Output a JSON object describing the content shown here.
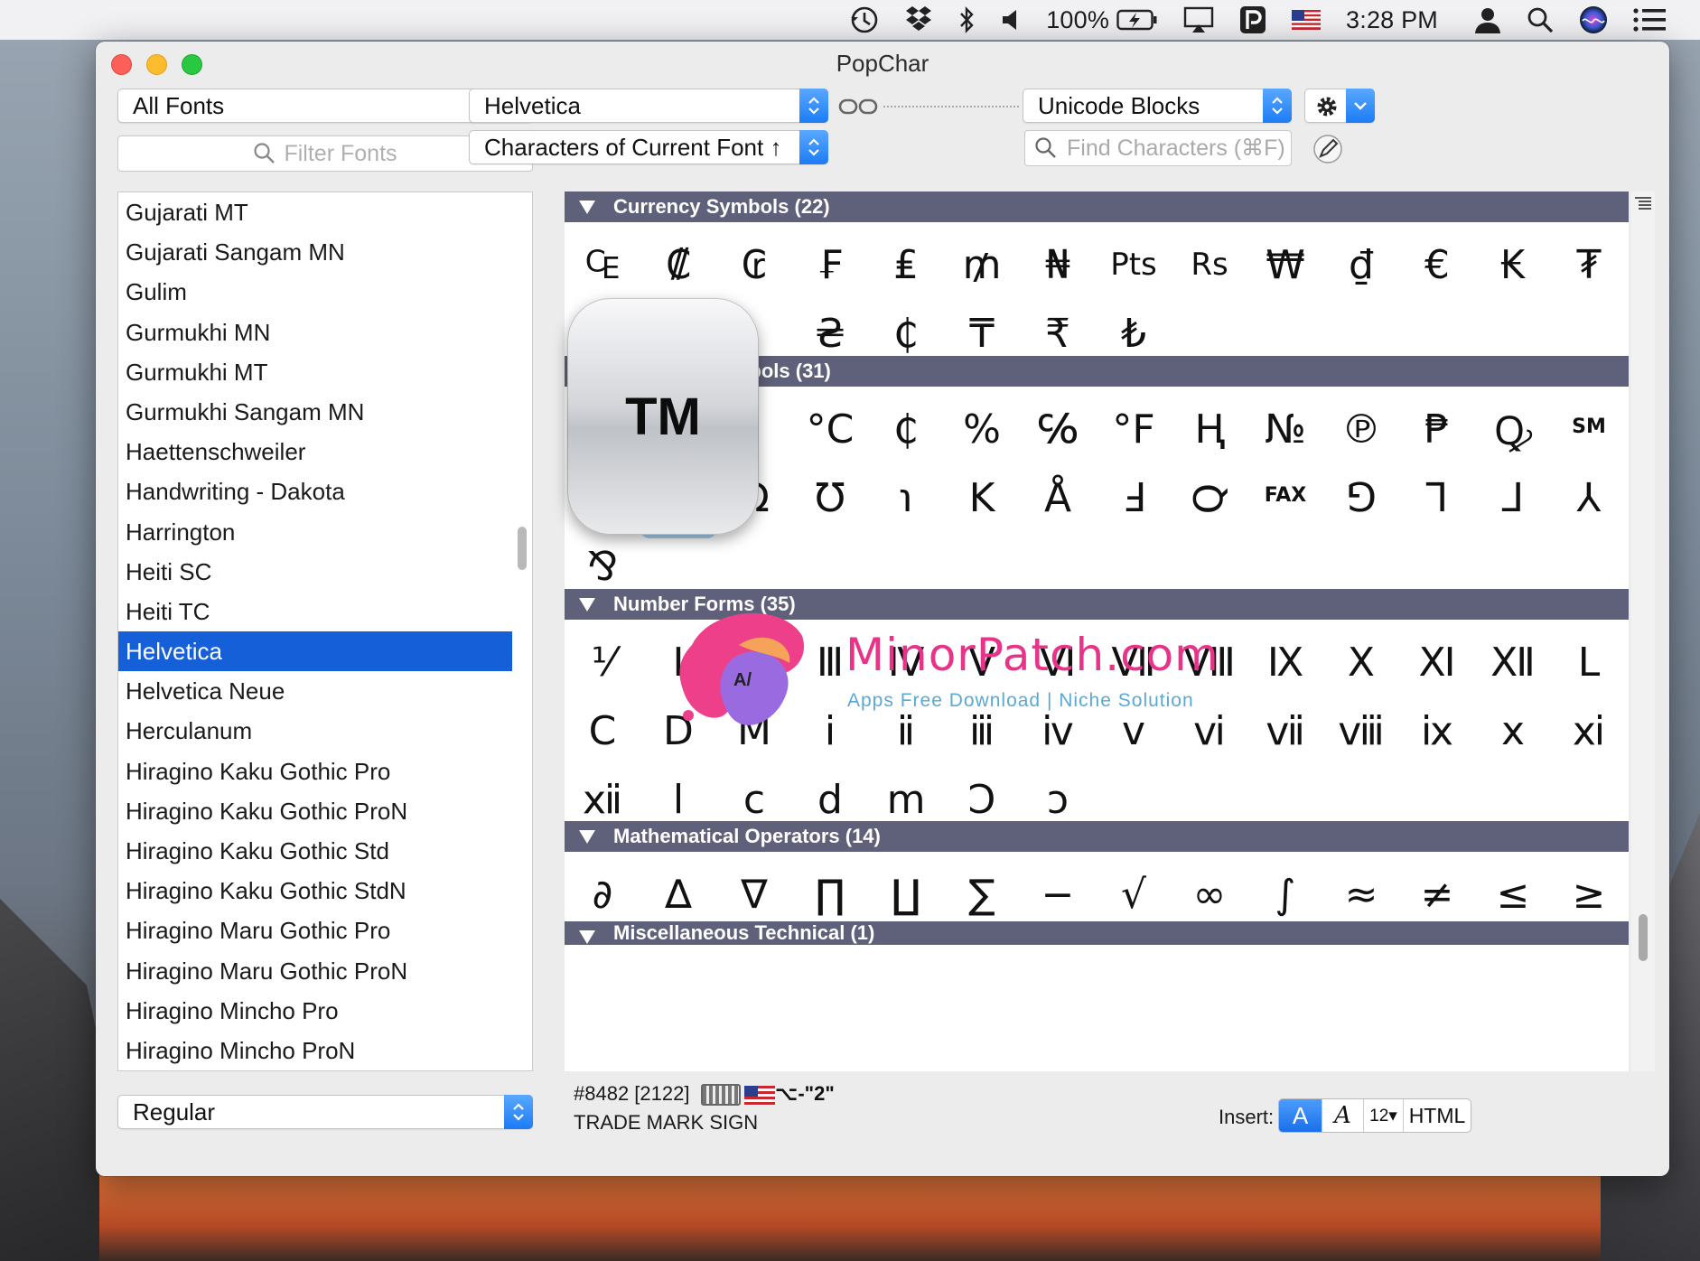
{
  "menubar": {
    "battery": "100%",
    "time": "3:28 PM"
  },
  "window": {
    "title": "PopChar"
  },
  "controls": {
    "font_collection": "All Fonts",
    "filter_placeholder": "Filter Fonts",
    "current_font": "Helvetica",
    "view_mode": "Characters of Current Font ↑",
    "grouping": "Unicode Blocks",
    "find_placeholder": "Find Characters (⌘F)"
  },
  "font_list": [
    "Gujarati MT",
    "Gujarati Sangam MN",
    "Gulim",
    "Gurmukhi MN",
    "Gurmukhi MT",
    "Gurmukhi Sangam MN",
    "Haettenschweiler",
    "Handwriting - Dakota",
    "Harrington",
    "Heiti SC",
    "Heiti TC",
    "Helvetica",
    "Helvetica Neue",
    "Herculanum",
    "Hiragino Kaku Gothic Pro",
    "Hiragino Kaku Gothic ProN",
    "Hiragino Kaku Gothic Std",
    "Hiragino Kaku Gothic StdN",
    "Hiragino Maru Gothic Pro",
    "Hiragino Maru Gothic ProN",
    "Hiragino Mincho Pro",
    "Hiragino Mincho ProN"
  ],
  "selected_font": "Helvetica",
  "sections": [
    {
      "title": "Currency Symbols (22)",
      "rows": [
        [
          "₠",
          "₡",
          "₢",
          "₣",
          "₤",
          "₥",
          "₦",
          "₧",
          "₨",
          "₩",
          "₫",
          "€",
          "₭",
          "₮"
        ],
        [
          "₱",
          "₲",
          "₳",
          "₴",
          "₵",
          "₸",
          "₹",
          "₺"
        ]
      ]
    },
    {
      "title": "Letterlike Symbols (31)",
      "rows": [
        [
          "℀",
          "℁",
          "℃",
          "℄",
          "℃",
          "₵",
          "%",
          "℅",
          "℉",
          "Ⱨ",
          "№",
          "℗",
          "℞",
          "℺",
          "℠"
        ],
        [
          "℡",
          "™",
          "Ω",
          "℧",
          "℩",
          "K",
          "Å",
          "Ⅎ",
          "℺",
          "℻",
          "⅁",
          "⅂",
          "⅃",
          "⅄"
        ],
        [
          "⅋"
        ]
      ]
    },
    {
      "title": "Number Forms (35)",
      "rows": [
        [
          "⅟",
          "Ⅰ",
          "Ⅱ",
          "Ⅲ",
          "Ⅳ",
          "Ⅴ",
          "Ⅵ",
          "Ⅶ",
          "Ⅷ",
          "Ⅸ",
          "Ⅹ",
          "Ⅺ",
          "Ⅻ",
          "Ⅼ"
        ],
        [
          "Ⅽ",
          "Ⅾ",
          "Ⅿ",
          "ⅰ",
          "ⅱ",
          "ⅲ",
          "ⅳ",
          "ⅴ",
          "ⅵ",
          "ⅶ",
          "ⅷ",
          "ⅸ",
          "ⅹ",
          "ⅺ"
        ],
        [
          "ⅻ",
          "ⅼ",
          "ⅽ",
          "ⅾ",
          "ⅿ",
          "Ↄ",
          "ↄ"
        ]
      ]
    },
    {
      "title": "Mathematical Operators (14)",
      "rows": [
        [
          "∂",
          "∆",
          "∇",
          "∏",
          "∐",
          "∑",
          "−",
          "√",
          "∞",
          "∫",
          "≈",
          "≠",
          "≤",
          "≥"
        ]
      ]
    },
    {
      "title": "Miscellaneous Technical (1)",
      "rows": []
    }
  ],
  "visible_rows": {
    "currency_1": [
      "₠",
      "₡",
      "₢",
      "₣",
      "₤",
      "₥",
      "₦",
      "Pts",
      "Rs",
      "₩",
      "₫",
      "€",
      "₭",
      "₮"
    ],
    "currency_2": [
      "",
      "",
      "",
      "₴",
      "₵",
      "₸",
      "₹",
      "₺"
    ],
    "letter_1": [
      "",
      "",
      "",
      "°C",
      "₵",
      "%",
      "℅",
      "°F",
      "Ⱨ",
      "№",
      "℗",
      "₱",
      "Ꝙ",
      "SM"
    ],
    "letter_2": [
      "TEL",
      "TM",
      "Ω",
      "℧",
      "℩",
      "K",
      "Å",
      "Ⅎ",
      "℺",
      "FAX",
      "⅁",
      "⅂",
      "⅃",
      "⅄"
    ],
    "letter_3": [
      "⅋"
    ],
    "number_1": [
      "⅟",
      "Ⅰ",
      "Ⅱ",
      "Ⅲ",
      "Ⅳ",
      "Ⅴ",
      "Ⅵ",
      "Ⅶ",
      "Ⅷ",
      "Ⅸ",
      "Ⅹ",
      "Ⅺ",
      "Ⅻ",
      "Ⅼ"
    ],
    "number_2": [
      "Ⅽ",
      "Ⅾ",
      "Ⅿ",
      "ⅰ",
      "ⅱ",
      "ⅲ",
      "ⅳ",
      "ⅴ",
      "ⅵ",
      "ⅶ",
      "ⅷ",
      "ⅸ",
      "ⅹ",
      "ⅺ"
    ],
    "number_3": [
      "ⅻ",
      "ⅼ",
      "ⅽ",
      "ⅾ",
      "ⅿ",
      "Ↄ",
      "ↄ"
    ],
    "math_1": [
      "∂",
      "∆",
      "∇",
      "∏",
      "∐",
      "∑",
      "−",
      "√",
      "∞",
      "∫",
      "≈",
      "≠",
      "≤",
      "≥"
    ]
  },
  "section_titles": {
    "currency": "Currency Symbols (22)",
    "letter": "Letterlike Symbols (31)",
    "number": "Number Forms (35)",
    "math": "Mathematical Operators (14)",
    "misc": "Miscellaneous Technical (1)"
  },
  "magnifier": {
    "glyph": "TM"
  },
  "style_popup": "Regular",
  "selected_char": {
    "code": "#8482 [2122]",
    "name": "TRADE MARK SIGN",
    "shortcut": "⌥-\"2\""
  },
  "insert": {
    "label": "Insert:",
    "plain": "A",
    "script": "A",
    "size": "12▾",
    "html": "HTML"
  },
  "watermark": {
    "title": "MinorPatch.com",
    "subtitle": "Apps Free Download | Niche Solution",
    "logo_text": "A/"
  },
  "colors": {
    "accent": "#1c7cf5",
    "section_bar": "#5f6079",
    "selection": "#1560d8"
  }
}
